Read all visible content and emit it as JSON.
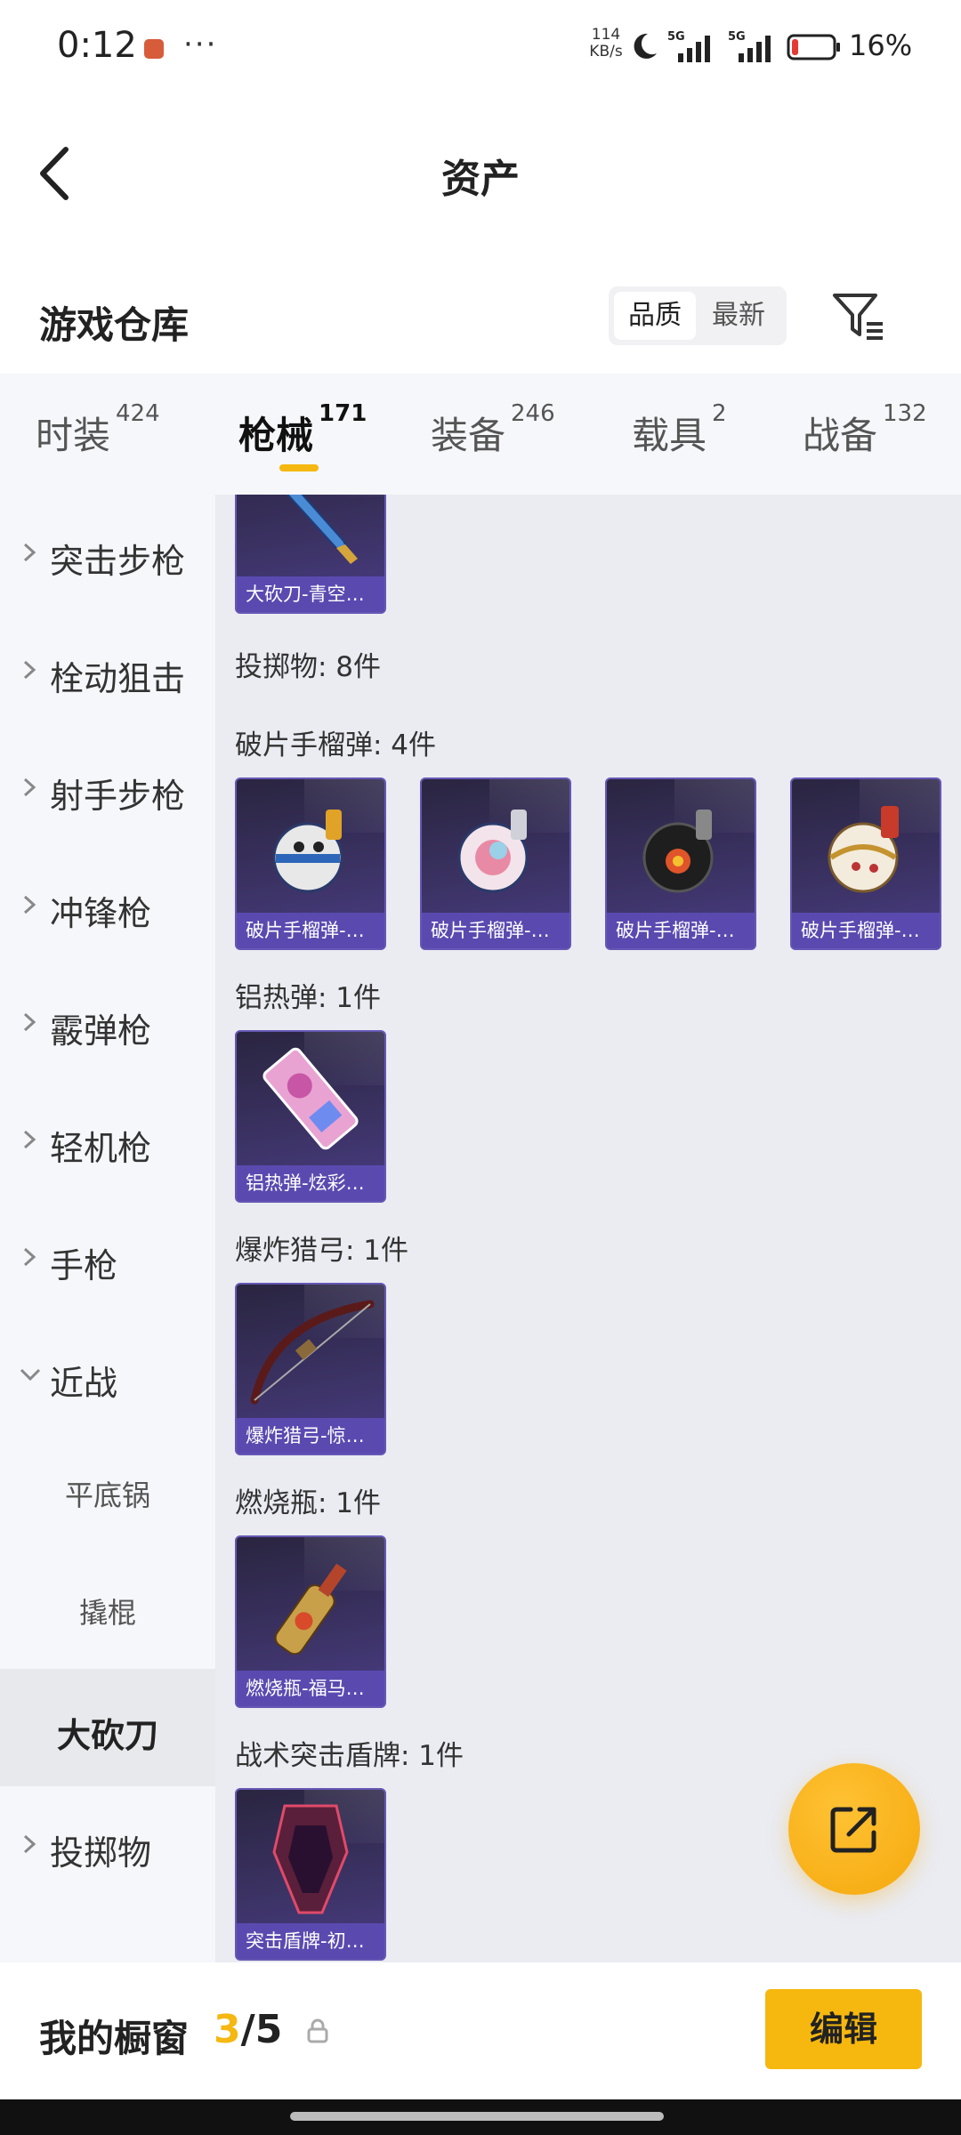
{
  "status_bar": {
    "time": "0:12",
    "dots": "···",
    "net_speed_value": "114",
    "net_speed_unit": "KB/s",
    "battery_pct": "16%",
    "battery_level": 0.16
  },
  "header": {
    "title": "资产"
  },
  "warehouse": {
    "title": "游戏仓库",
    "sort_quality": "品质",
    "sort_latest": "最新"
  },
  "tabs": [
    {
      "label": "时装",
      "count": "424"
    },
    {
      "label": "枪械",
      "count": "171"
    },
    {
      "label": "装备",
      "count": "246"
    },
    {
      "label": "载具",
      "count": "2"
    },
    {
      "label": "战备",
      "count": "132"
    }
  ],
  "sidebar": {
    "items": [
      {
        "label": "突击步枪"
      },
      {
        "label": "栓动狙击"
      },
      {
        "label": "射手步枪"
      },
      {
        "label": "冲锋枪"
      },
      {
        "label": "霰弹枪"
      },
      {
        "label": "轻机枪"
      },
      {
        "label": "手枪"
      },
      {
        "label": "近战"
      },
      {
        "label": "平底锅"
      },
      {
        "label": "撬棍"
      },
      {
        "label": "大砍刀"
      },
      {
        "label": "投掷物"
      }
    ]
  },
  "content": {
    "top_card": {
      "name": "大砍刀-青空…"
    },
    "throwables_header": "投掷物: 8件",
    "frag_header": "破片手榴弹: 4件",
    "frag_cards": [
      {
        "name": "破片手榴弹-…"
      },
      {
        "name": "破片手榴弹-…"
      },
      {
        "name": "破片手榴弹-…"
      },
      {
        "name": "破片手榴弹-…"
      }
    ],
    "thermite_header": "铝热弹: 1件",
    "thermite_card": {
      "name": "铝热弹-炫彩…"
    },
    "bow_header": "爆炸猎弓: 1件",
    "bow_card": {
      "name": "爆炸猎弓-惊…"
    },
    "molotov_header": "燃烧瓶: 1件",
    "molotov_card": {
      "name": "燃烧瓶-福马…"
    },
    "shield_header": "战术突击盾牌: 1件",
    "shield_card": {
      "name": "突击盾牌-初…"
    }
  },
  "showcase": {
    "title": "我的橱窗",
    "current": "3",
    "total": "/5",
    "edit_label": "编辑"
  },
  "colors": {
    "accent": "#f5b711",
    "card_label": "#5a4ab0",
    "content_bg": "#eaecf2"
  }
}
